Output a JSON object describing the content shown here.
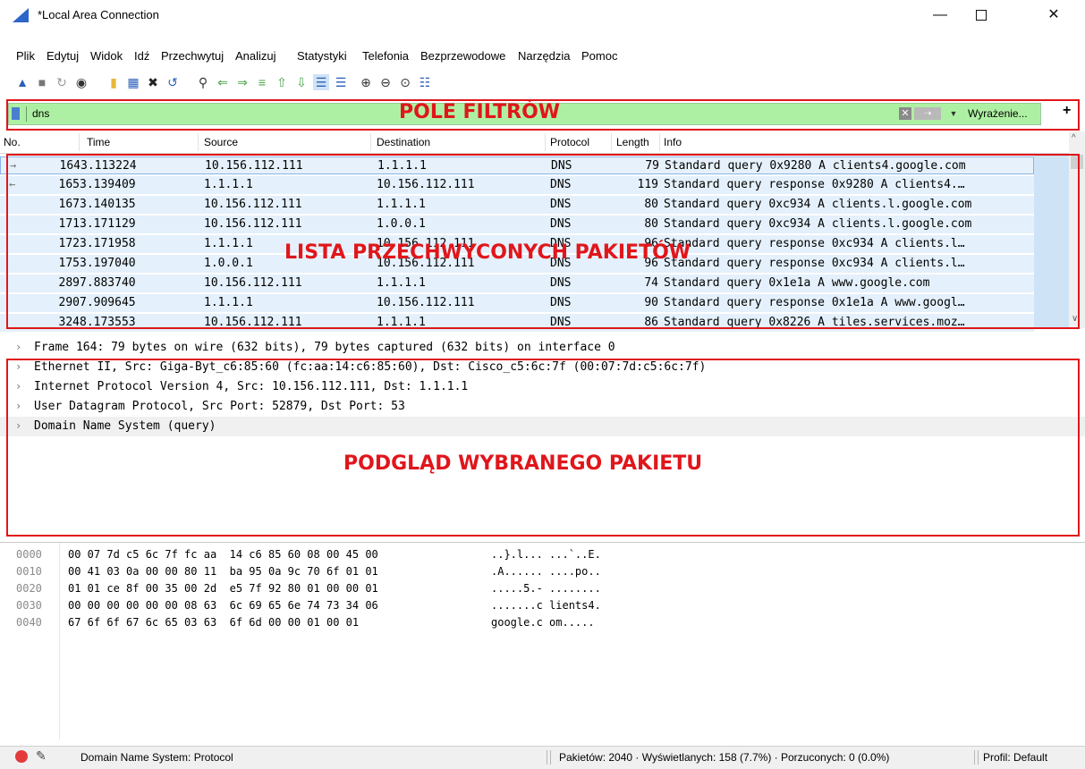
{
  "window": {
    "title": "*Local Area Connection"
  },
  "menu": [
    "Plik",
    "Edytuj",
    "Widok",
    "Idź",
    "Przechwytuj",
    "Analizuj",
    "Statystyki",
    "Telefonia",
    "Bezprzewodowe",
    "Narzędzia",
    "Pomoc"
  ],
  "filter": {
    "value": "dns",
    "expression_label": "Wyrażenie...",
    "add_label": "+"
  },
  "annotations": {
    "filter": "POLE FILTRÓW",
    "list": "LISTA PRZECHWYCONYCH PAKIETÓW",
    "detail": "PODGLĄD WYBRANEGO PAKIETU"
  },
  "packet_list": {
    "columns": [
      "No.",
      "Time",
      "Source",
      "Destination",
      "Protocol",
      "Length",
      "Info"
    ],
    "rows": [
      {
        "no": "164",
        "time": "3.113224",
        "src": "10.156.112.111",
        "dst": "1.1.1.1",
        "proto": "DNS",
        "len": "79",
        "info": "Standard query 0x9280 A clients4.google.com"
      },
      {
        "no": "165",
        "time": "3.139409",
        "src": "1.1.1.1",
        "dst": "10.156.112.111",
        "proto": "DNS",
        "len": "119",
        "info": "Standard query response 0x9280 A clients4.…"
      },
      {
        "no": "167",
        "time": "3.140135",
        "src": "10.156.112.111",
        "dst": "1.1.1.1",
        "proto": "DNS",
        "len": "80",
        "info": "Standard query 0xc934 A clients.l.google.com"
      },
      {
        "no": "171",
        "time": "3.171129",
        "src": "10.156.112.111",
        "dst": "1.0.0.1",
        "proto": "DNS",
        "len": "80",
        "info": "Standard query 0xc934 A clients.l.google.com"
      },
      {
        "no": "172",
        "time": "3.171958",
        "src": "1.1.1.1",
        "dst": "10.156.112.111",
        "proto": "DNS",
        "len": "96",
        "info": "Standard query response 0xc934 A clients.l…"
      },
      {
        "no": "175",
        "time": "3.197040",
        "src": "1.0.0.1",
        "dst": "10.156.112.111",
        "proto": "DNS",
        "len": "96",
        "info": "Standard query response 0xc934 A clients.l…"
      },
      {
        "no": "289",
        "time": "7.883740",
        "src": "10.156.112.111",
        "dst": "1.1.1.1",
        "proto": "DNS",
        "len": "74",
        "info": "Standard query 0x1e1a A www.google.com"
      },
      {
        "no": "290",
        "time": "7.909645",
        "src": "1.1.1.1",
        "dst": "10.156.112.111",
        "proto": "DNS",
        "len": "90",
        "info": "Standard query response 0x1e1a A www.googl…"
      },
      {
        "no": "324",
        "time": "8.173553",
        "src": "10.156.112.111",
        "dst": "1.1.1.1",
        "proto": "DNS",
        "len": "86",
        "info": "Standard query 0x8226 A tiles.services.moz…"
      }
    ]
  },
  "details": [
    "Frame 164: 79 bytes on wire (632 bits), 79 bytes captured (632 bits) on interface 0",
    "Ethernet II, Src: Giga-Byt_c6:85:60 (fc:aa:14:c6:85:60), Dst: Cisco_c5:6c:7f (00:07:7d:c5:6c:7f)",
    "Internet Protocol Version 4, Src: 10.156.112.111, Dst: 1.1.1.1",
    "User Datagram Protocol, Src Port: 52879, Dst Port: 53",
    "Domain Name System (query)"
  ],
  "bytes": [
    {
      "off": "0000",
      "hex": "00 07 7d c5 6c 7f fc aa  14 c6 85 60 08 00 45 00",
      "ascii": "..}.l... ...`..E."
    },
    {
      "off": "0010",
      "hex": "00 41 03 0a 00 00 80 11  ba 95 0a 9c 70 6f 01 01",
      "ascii": ".A...... ....po.."
    },
    {
      "off": "0020",
      "hex": "01 01 ce 8f 00 35 00 2d  e5 7f 92 80 01 00 00 01",
      "ascii": ".....5.- ........"
    },
    {
      "off": "0030",
      "hex": "00 00 00 00 00 00 08 63  6c 69 65 6e 74 73 34 06",
      "ascii": ".......c lients4."
    },
    {
      "off": "0040",
      "hex": "67 6f 6f 67 6c 65 03 63  6f 6d 00 00 01 00 01",
      "ascii": "google.c om....."
    }
  ],
  "status": {
    "protocol": "Domain Name System: Protocol",
    "counts": "Pakietów: 2040 · Wyświetlanych: 158 (7.7%) · Porzuconych: 0 (0.0%)",
    "profile": "Profil: Default"
  },
  "colors": {
    "accent": "#2c66c8",
    "filter_bg": "#aef0a3",
    "row_bg": "#e4f0fb",
    "annotation": "#e0161b"
  }
}
